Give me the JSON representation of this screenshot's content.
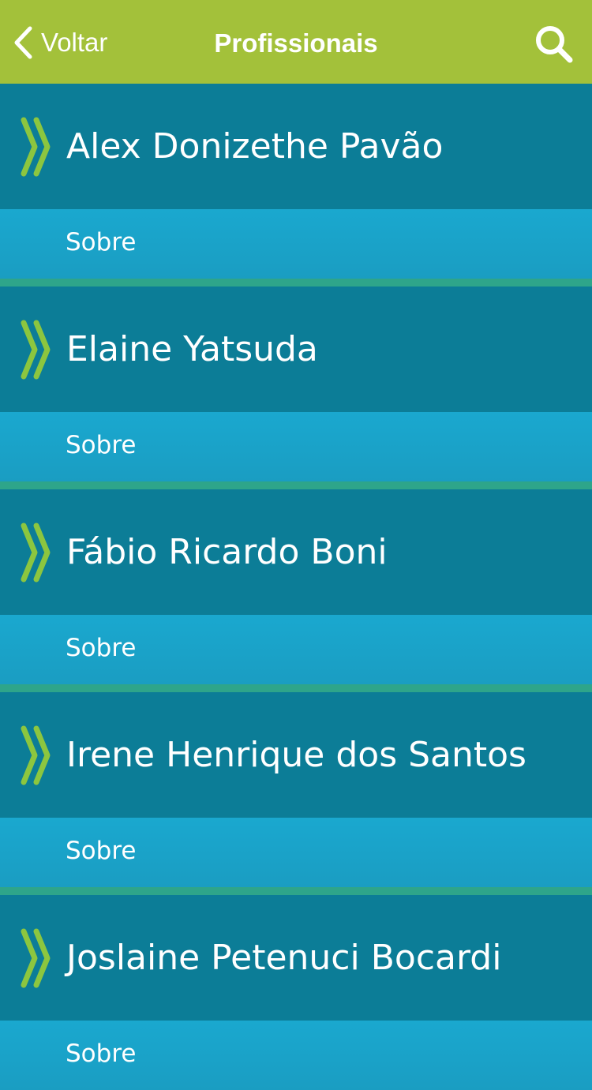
{
  "nav": {
    "back_label": "Voltar",
    "title": "Profissionais"
  },
  "entries": [
    {
      "name": "Alex Donizethe Pavão",
      "sobre": "Sobre"
    },
    {
      "name": "Elaine Yatsuda",
      "sobre": "Sobre"
    },
    {
      "name": "Fábio Ricardo Boni",
      "sobre": "Sobre"
    },
    {
      "name": "Irene Henrique dos Santos",
      "sobre": "Sobre"
    },
    {
      "name": "Joslaine Petenuci Bocardi",
      "sobre": "Sobre"
    }
  ],
  "icons": {
    "back": "chevron-left-icon",
    "search": "search-icon",
    "entry": "double-chevron-right-icon"
  },
  "colors": {
    "nav_bg": "#a3c13a",
    "name_row_bg": "#0c7d97",
    "sobre_row_bg": "#1aa8cf",
    "divider": "#2ea58a",
    "chevron": "#8cc63f",
    "text": "#ffffff"
  }
}
